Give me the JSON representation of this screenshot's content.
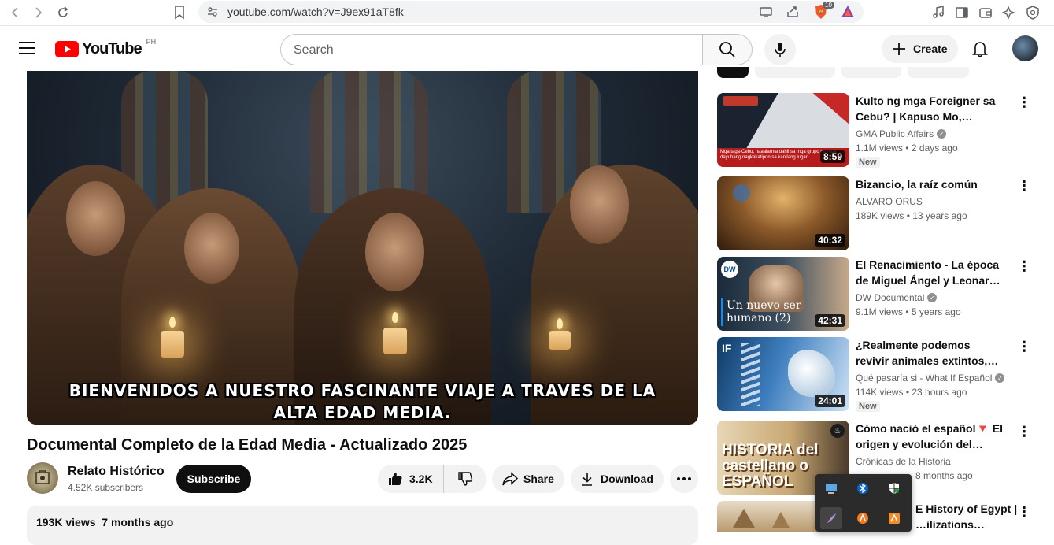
{
  "browser": {
    "url": "youtube.com/watch?v=J9ex91aT8fk",
    "brave_badge": "10"
  },
  "header": {
    "logo_text": "YouTube",
    "country_code": "PH",
    "search_placeholder": "Search",
    "create_label": "Create"
  },
  "player": {
    "subtitle": "BIENVENIDOS A NUESTRO FASCINANTE VIAJE A TRAVES DE LA ALTA EDAD MEDIA."
  },
  "video": {
    "title": "Documental Completo de la Edad Media - Actualizado 2025",
    "channel_name": "Relato Histórico",
    "subscribers": "4.52K subscribers",
    "subscribe_label": "Subscribe",
    "likes": "3.2K",
    "share_label": "Share",
    "download_label": "Download",
    "views": "193K views",
    "age": "7 months ago"
  },
  "recommendations": [
    {
      "title": "Kulto ng mga Foreigner sa Cebu? | Kapuso Mo, Jessica…",
      "channel": "GMA Public Affairs",
      "verified": true,
      "views": "1.1M views",
      "age": "2 days ago",
      "duration": "8:59",
      "badge": "New",
      "thumb_caption": "Mga taga-Cebu, naaalarma dahil sa mga grupo ng mga dayuhang nagkakatipon sa kanilang lugar"
    },
    {
      "title": "Bizancio, la raíz común",
      "channel": "ALVARO ORUS",
      "verified": false,
      "views": "189K views",
      "age": "13 years ago",
      "duration": "40:32",
      "badge": ""
    },
    {
      "title": "El Renacimiento - La época de Miguel Ángel y Leonardo da…",
      "channel": "DW Documental",
      "verified": true,
      "views": "9.1M views",
      "age": "5 years ago",
      "duration": "42:31",
      "badge": "",
      "thumb_caption": "Un nuevo ser humano (2)"
    },
    {
      "title": "¿Realmente podemos revivir animales extintos, como el lob…",
      "channel": "Qué pasaría si - What If Español",
      "verified": true,
      "views": "114K views",
      "age": "23 hours ago",
      "duration": "24:01",
      "badge": "New"
    },
    {
      "title": "Cómo nació el español🔻 El origen y evolución del idioma…",
      "channel": "Crónicas de la Historia",
      "verified": false,
      "views": "",
      "age": "8 months ago",
      "duration": "",
      "badge": "",
      "thumb_caption": "HISTORIA del castellano o ESPAÑOL"
    },
    {
      "title": "E History of Egypt | …ilizations…",
      "channel": "",
      "verified": false,
      "views": "",
      "age": "",
      "duration": "",
      "badge": ""
    }
  ],
  "colors": {
    "yt_red": "#ff0000",
    "subscribe_bg": "#0f0f0f",
    "pill_bg": "#f2f2f2",
    "secondary_text": "#606060"
  }
}
